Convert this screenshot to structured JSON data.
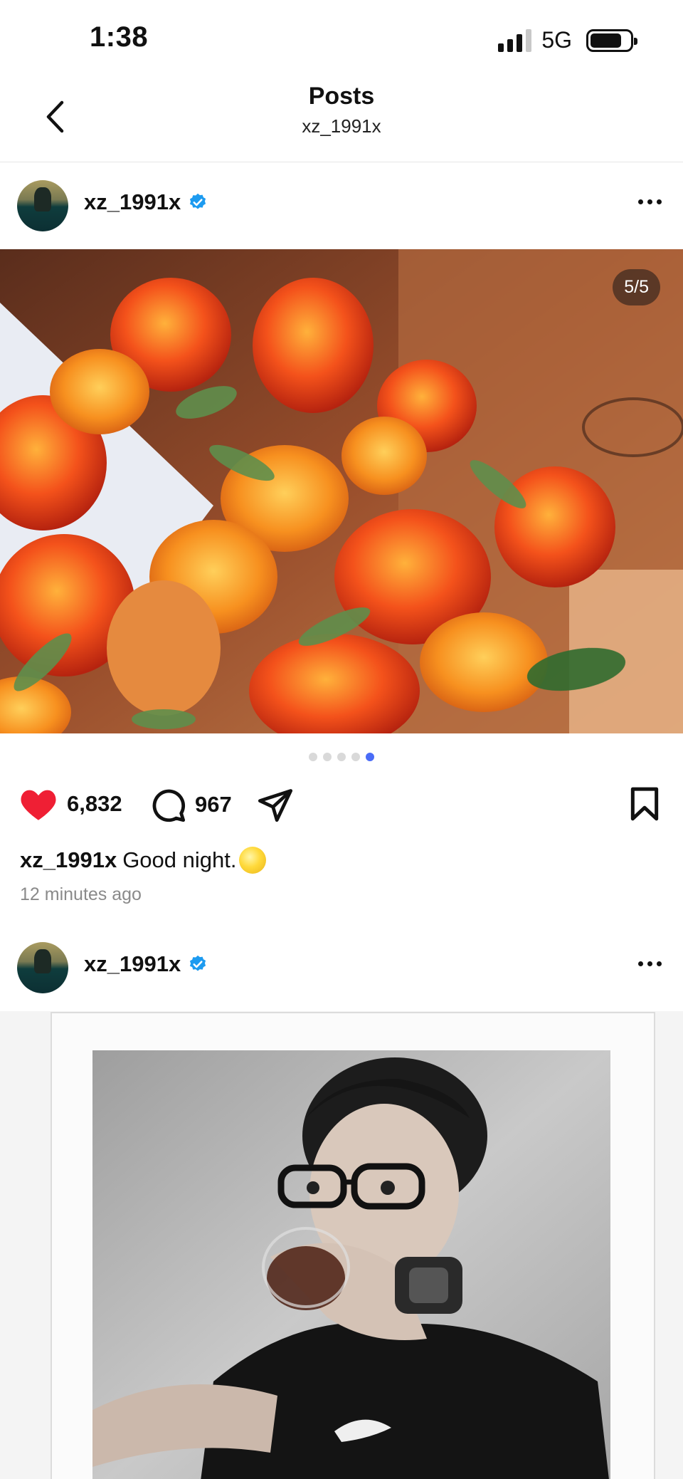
{
  "status_bar": {
    "time": "1:38",
    "network": "5G",
    "signal_bars": 3,
    "battery_level": 0.8
  },
  "header": {
    "title": "Posts",
    "subtitle": "xz_1991x",
    "back_icon": "chevron-left-icon"
  },
  "posts": [
    {
      "username": "xz_1991x",
      "verified": true,
      "image_counter": "5/5",
      "carousel_active_index": 4,
      "carousel_total": 5,
      "likes": "6,832",
      "comments": "967",
      "caption_user": "xz_1991x",
      "caption_text": "Good night.",
      "caption_emoji": "moon",
      "timestamp": "12 minutes ago"
    },
    {
      "username": "xz_1991x",
      "verified": true
    }
  ],
  "colors": {
    "like_red": "#ef1f34",
    "verified_blue": "#1d9bf0",
    "carousel_active": "#4a6cf7",
    "timestamp_gray": "#8a8a8a"
  }
}
